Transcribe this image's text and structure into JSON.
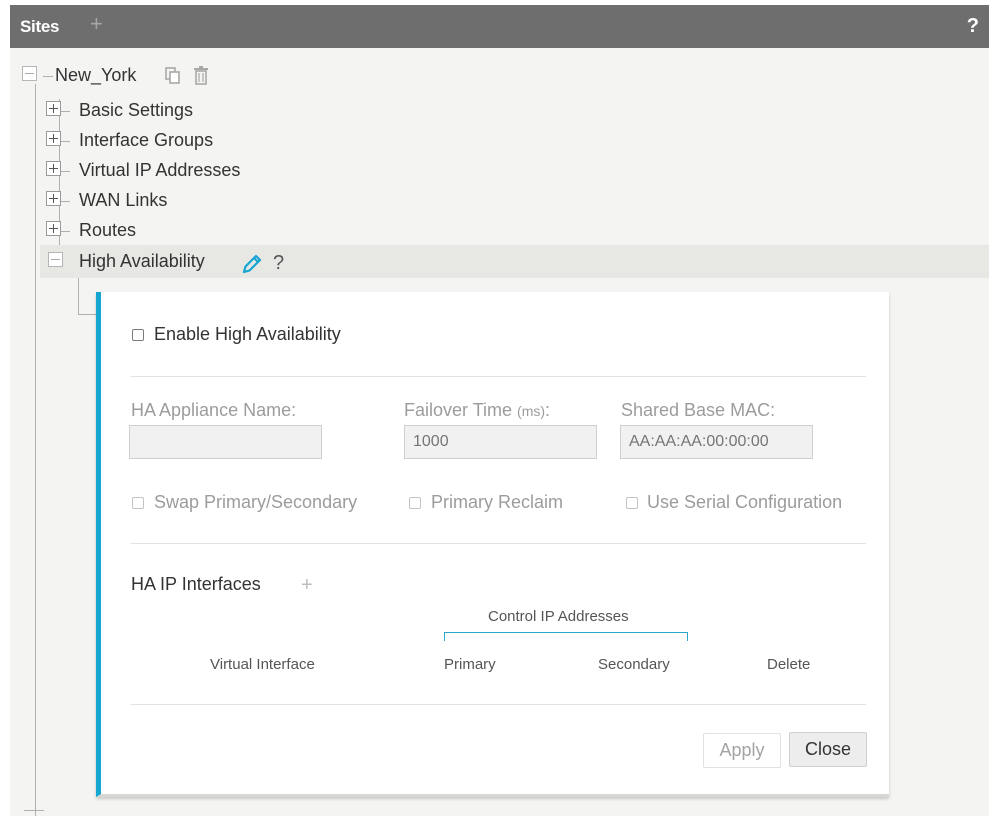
{
  "header": {
    "title": "Sites",
    "add_icon": "plus-icon",
    "help_label": "?"
  },
  "tree": {
    "site": {
      "name": "New_York",
      "actions": [
        "copy-icon",
        "trash-icon"
      ]
    },
    "nodes": [
      {
        "label": "Basic Settings",
        "state": "collapsed"
      },
      {
        "label": "Interface Groups",
        "state": "collapsed"
      },
      {
        "label": "Virtual IP Addresses",
        "state": "collapsed"
      },
      {
        "label": "WAN Links",
        "state": "collapsed"
      },
      {
        "label": "Routes",
        "state": "collapsed"
      },
      {
        "label": "High Availability",
        "state": "expanded",
        "edit_icon": "pencil-icon",
        "help_label": "?"
      }
    ]
  },
  "ha_panel": {
    "enable_label": "Enable High Availability",
    "enable_checked": false,
    "appliance_name": {
      "label": "HA Appliance Name:",
      "value": ""
    },
    "failover_time": {
      "label": "Failover Time",
      "unit": "(ms)",
      "colon": ":",
      "placeholder": "1000"
    },
    "shared_mac": {
      "label": "Shared Base MAC:",
      "placeholder": "AA:AA:AA:00:00:00"
    },
    "options": [
      {
        "label": "Swap Primary/Secondary",
        "checked": false
      },
      {
        "label": "Primary Reclaim",
        "checked": false
      },
      {
        "label": "Use Serial Configuration",
        "checked": false
      }
    ],
    "ip_interfaces": {
      "title": "HA IP Interfaces",
      "add_icon": "plus-icon",
      "group_header": "Control IP Addresses",
      "columns": [
        "Virtual Interface",
        "Primary",
        "Secondary",
        "Delete"
      ],
      "rows": []
    },
    "buttons": {
      "apply": "Apply",
      "close": "Close"
    }
  },
  "colors": {
    "header_bg": "#6e6e6e",
    "accent": "#14a5d0",
    "workspace_bg": "#f4f4f2"
  }
}
